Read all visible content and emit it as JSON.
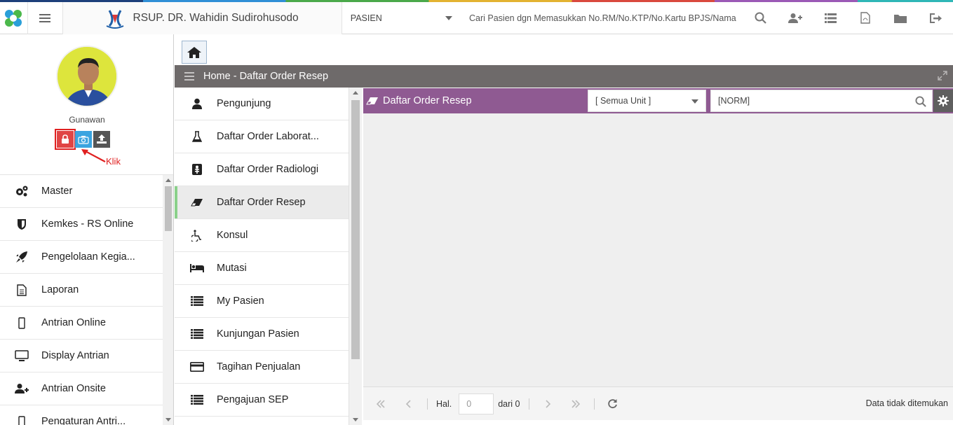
{
  "header": {
    "hospital_name": "RSUP. DR. Wahidin Sudirohusodo",
    "mode_select": "PASIEN",
    "search_placeholder": "Cari Pasien dgn Memasukkan No.RM/No.KTP/No.Kartu BPJS/Nama",
    "icons": [
      "search-icon",
      "add-user-icon",
      "list-icon",
      "pdf-icon",
      "folder-icon",
      "logout-icon"
    ]
  },
  "profile": {
    "name": "Gunawan",
    "annotation": "Klik"
  },
  "sidebar": {
    "items": [
      {
        "label": "Master",
        "icon": "gears-icon"
      },
      {
        "label": "Kemkes - RS Online",
        "icon": "shield-icon"
      },
      {
        "label": "Pengelolaan Kegia...",
        "icon": "rocket-icon"
      },
      {
        "label": "Laporan",
        "icon": "document-icon"
      },
      {
        "label": "Antrian Online",
        "icon": "mobile-icon"
      },
      {
        "label": "Display Antrian",
        "icon": "monitor-icon"
      },
      {
        "label": "Antrian Onsite",
        "icon": "user-plus-icon"
      },
      {
        "label": "Pengaturan Antri...",
        "icon": "mobile-icon"
      }
    ]
  },
  "breadcrumb": {
    "text": "Home - Daftar Order Resep"
  },
  "submenu": {
    "items": [
      {
        "label": "Pengunjung",
        "icon": "user-icon"
      },
      {
        "label": "Daftar Order Laborat...",
        "icon": "flask-icon"
      },
      {
        "label": "Daftar Order Radiologi",
        "icon": "xray-icon"
      },
      {
        "label": "Daftar Order Resep",
        "icon": "eraser-icon"
      },
      {
        "label": "Konsul",
        "icon": "wheelchair-icon"
      },
      {
        "label": "Mutasi",
        "icon": "bed-icon"
      },
      {
        "label": "My Pasien",
        "icon": "list-icon"
      },
      {
        "label": "Kunjungan Pasien",
        "icon": "list-icon"
      },
      {
        "label": "Tagihan Penjualan",
        "icon": "credit-card-icon"
      },
      {
        "label": "Pengajuan SEP",
        "icon": "list-icon"
      }
    ],
    "active": "Daftar Order Resep"
  },
  "panel": {
    "title": "Daftar Order Resep",
    "unit_select": "[ Semua Unit ]",
    "norm_placeholder": "[NORM]"
  },
  "pager": {
    "page_label": "Hal.",
    "page_value": "0",
    "of_label": "dari 0",
    "status": "Data tidak ditemukan"
  },
  "colors": {
    "panel_header": "#8f5a92",
    "breadcrumb_bar": "#6e6a6a",
    "active_marker": "#8ad08a",
    "annotation": "#e02020"
  }
}
